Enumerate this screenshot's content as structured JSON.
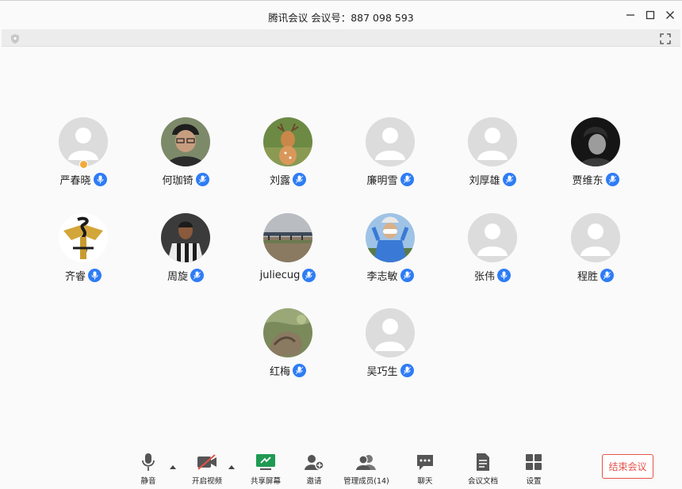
{
  "window": {
    "title": "腾讯会议 会议号：887 098 593"
  },
  "colors": {
    "accent": "#2e7cf6",
    "danger": "#e5534b",
    "host_badge": "#f2a93b"
  },
  "participants": [
    {
      "name": "严春晓",
      "avatar": "default",
      "host": true
    },
    {
      "name": "何珈锜",
      "avatar": "photo-person-beanie"
    },
    {
      "name": "刘露",
      "avatar": "photo-deer"
    },
    {
      "name": "廉明雪",
      "avatar": "default"
    },
    {
      "name": "刘厚雄",
      "avatar": "default"
    },
    {
      "name": "贾维东",
      "avatar": "photo-dark-portrait"
    },
    {
      "name": "齐睿",
      "avatar": "logo-gold-snake"
    },
    {
      "name": "周旋",
      "avatar": "photo-soccer-player"
    },
    {
      "name": "juliecug",
      "avatar": "photo-river-bridge"
    },
    {
      "name": "李志敏",
      "avatar": "photo-person-blue-sky"
    },
    {
      "name": "张伟",
      "avatar": "default"
    },
    {
      "name": "程胜",
      "avatar": "default"
    },
    {
      "name": "红梅",
      "avatar": "photo-moss-rock"
    },
    {
      "name": "吴巧生",
      "avatar": "default"
    }
  ],
  "toolbar": {
    "mute_label": "静音",
    "video_label": "开启视频",
    "share_label": "共享屏幕",
    "invite_label": "邀请",
    "members_label": "管理成员(14)",
    "chat_label": "聊天",
    "docs_label": "会议文档",
    "settings_label": "设置",
    "end_label": "结束会议"
  }
}
